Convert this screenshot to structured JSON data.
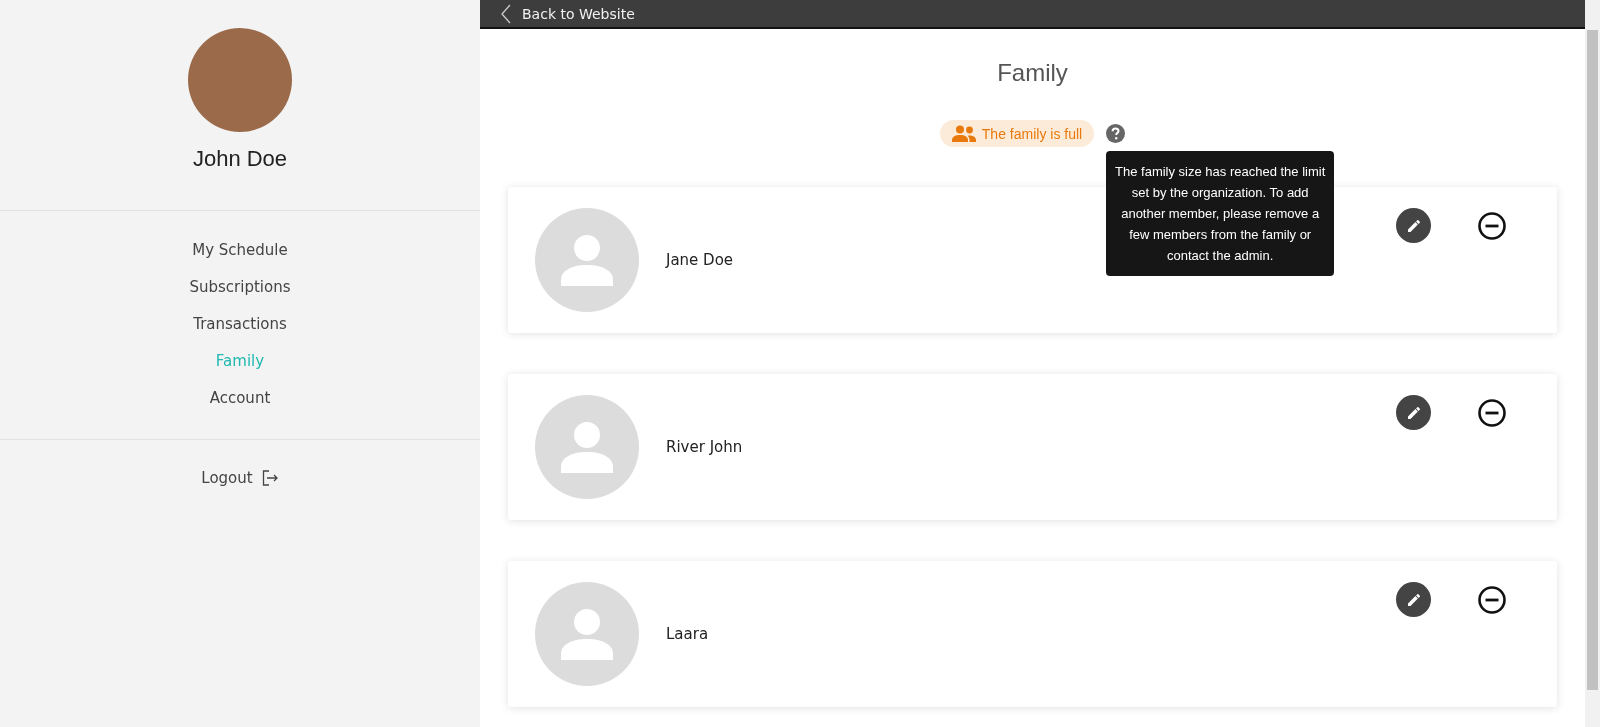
{
  "user": {
    "name": "John Doe"
  },
  "sidebar": {
    "items": [
      {
        "label": "My Schedule",
        "selected": false
      },
      {
        "label": "Subscriptions",
        "selected": false
      },
      {
        "label": "Transactions",
        "selected": false
      },
      {
        "label": "Family",
        "selected": true
      },
      {
        "label": "Account",
        "selected": false
      }
    ],
    "logout": "Logout"
  },
  "top_bar": {
    "back_link": "Back to Website"
  },
  "page": {
    "title": "Family",
    "status_badge": "The family is full",
    "tooltip": "The family size has reached the limit set by the organization. To add another member, please remove a few members from the family or contact the admin."
  },
  "members": [
    {
      "name": "Jane Doe"
    },
    {
      "name": "River John"
    },
    {
      "name": "Laara"
    }
  ]
}
